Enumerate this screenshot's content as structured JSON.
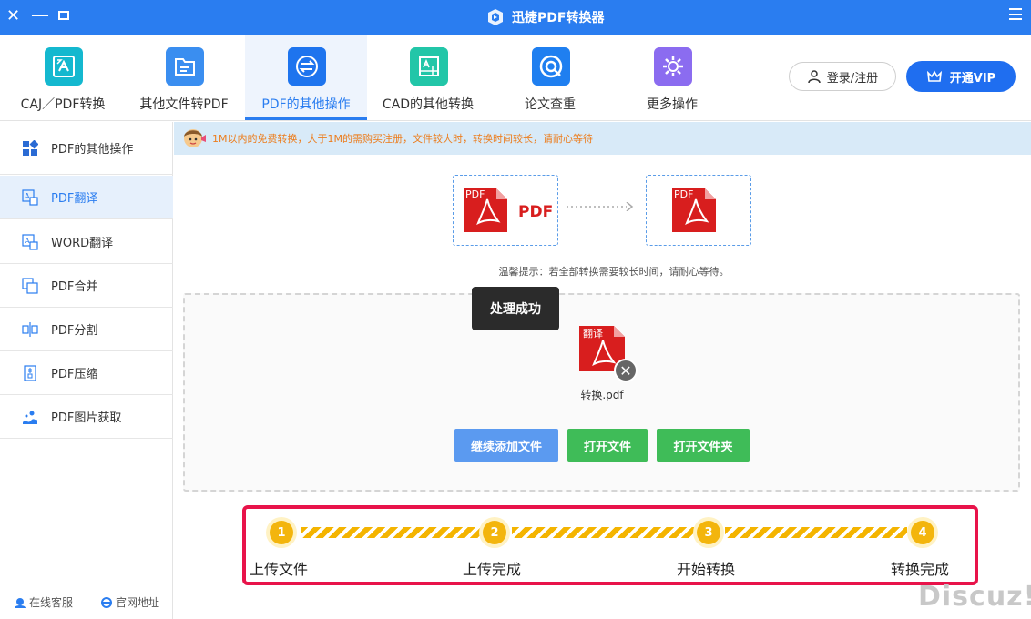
{
  "window": {
    "title": "迅捷PDF转换器",
    "controls": {
      "close": "✕",
      "minimize": "—"
    }
  },
  "nav": {
    "tabs": [
      {
        "label": "CAJ／PDF转换",
        "icon": "caj-pdf-icon",
        "color": "#14b8cf"
      },
      {
        "label": "其他文件转PDF",
        "icon": "folder-icon",
        "color": "#3a8ef0"
      },
      {
        "label": "PDF的其他操作",
        "icon": "pdf-operation-icon",
        "color": "#1e74ee",
        "active": true
      },
      {
        "label": "CAD的其他转换",
        "icon": "cad-icon",
        "color": "#22c6a8"
      },
      {
        "label": "论文查重",
        "icon": "paper-check-icon",
        "color": "#1f7ff0"
      },
      {
        "label": "更多操作",
        "icon": "gear-icon",
        "color": "#8b6cf0"
      }
    ],
    "login_label": "登录/注册",
    "vip_label": "开通VIP"
  },
  "sidebar": {
    "header": "PDF的其他操作",
    "items": [
      {
        "label": "PDF翻译",
        "icon": "translate-icon",
        "active": true
      },
      {
        "label": "WORD翻译",
        "icon": "translate-icon"
      },
      {
        "label": "PDF合并",
        "icon": "merge-icon"
      },
      {
        "label": "PDF分割",
        "icon": "split-icon"
      },
      {
        "label": "PDF压缩",
        "icon": "compress-icon"
      },
      {
        "label": "PDF图片获取",
        "icon": "image-extract-icon"
      }
    ],
    "footer": {
      "service": "在线客服",
      "website": "官网地址"
    }
  },
  "notice": "1M以内的免费转换，大于1M的需购买注册，文件较大时，转换时间较长，请耐心等待",
  "convert": {
    "source_tag": "PDF",
    "source_label": "PDF",
    "target_tag": "PDF",
    "tip": "温馨提示：若全部转换需要较长时间，请耐心等待。"
  },
  "dropzone": {
    "toast": "处理成功",
    "file": {
      "tag": "翻译",
      "name": "转换.pdf"
    },
    "buttons": {
      "add": "继续添加文件",
      "open_file": "打开文件",
      "open_folder": "打开文件夹"
    }
  },
  "steps": [
    {
      "number": "1",
      "label": "上传文件"
    },
    {
      "number": "2",
      "label": "上传完成"
    },
    {
      "number": "3",
      "label": "开始转换"
    },
    {
      "number": "4",
      "label": "转换完成"
    }
  ],
  "watermark": "Discuz!",
  "colors": {
    "accent": "#2a7df0",
    "pdf_red": "#d81e1e",
    "success_green": "#3fbc58",
    "steps_border": "#e8134a"
  }
}
